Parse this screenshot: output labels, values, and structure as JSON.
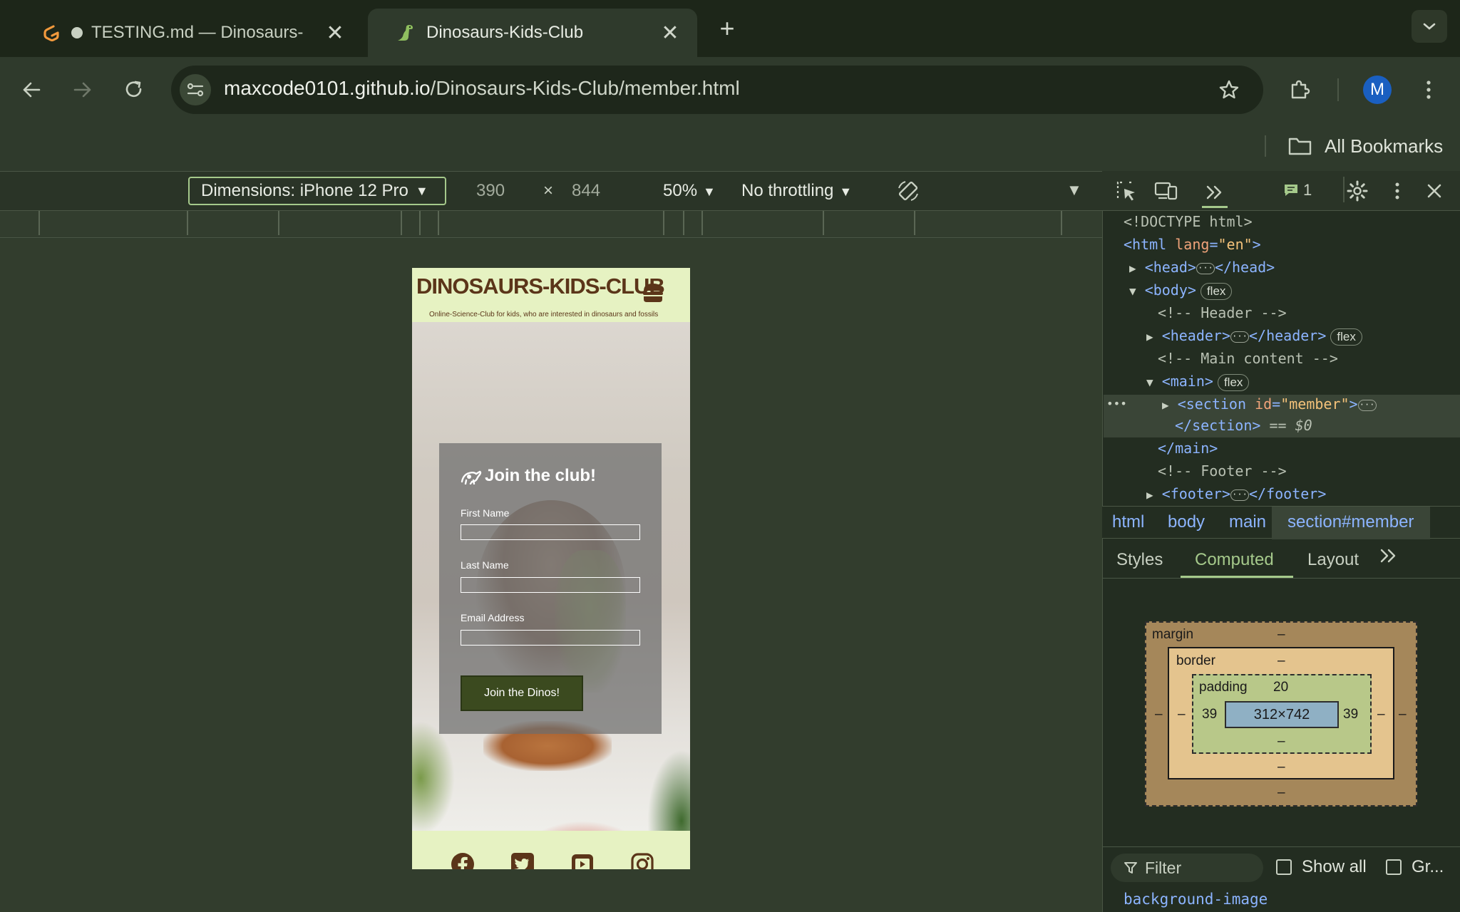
{
  "tabs": [
    {
      "title": "TESTING.md — Dinosaurs-",
      "active": false,
      "unsaved": true
    },
    {
      "title": "Dinosaurs-Kids-Club",
      "active": true
    }
  ],
  "address": {
    "host": "maxcode0101.github.io",
    "path": "/Dinosaurs-Kids-Club/member.html"
  },
  "profile_initial": "M",
  "bookmarks_label": "All Bookmarks",
  "device_toolbar": {
    "dimensions": "Dimensions: iPhone 12 Pro",
    "width": "390",
    "times": "×",
    "height": "844",
    "zoom": "50%",
    "throttling": "No throttling"
  },
  "site": {
    "logo": "DINOSAURS-KIDS-CLUB",
    "tagline": "Online-Science-Club for kids, who are interested in dinosaurs and fossils",
    "form_title": "Join the club!",
    "first_name_label": "First Name",
    "last_name_label": "Last Name",
    "email_label": "Email Address",
    "button_label": "Join the Dinos!"
  },
  "devtools": {
    "issues_count": "1",
    "dom": {
      "doctype": "<!DOCTYPE html>",
      "html_open": "<html",
      "lang_attr": "lang",
      "lang_val": "\"en\"",
      "head": "<head>",
      "head_close": "</head>",
      "body": "<body>",
      "flex": "flex",
      "c_header": "<!-- Header -->",
      "header": "<header>",
      "header_close": "</header>",
      "c_main": "<!-- Main content -->",
      "main": "<main>",
      "section_open": "<section",
      "id_attr": "id",
      "id_val": "\"member\"",
      "section_close": "</section>",
      "eq": "== $0",
      "main_close": "</main>",
      "c_footer": "<!-- Footer -->",
      "footer": "<footer>",
      "footer_close": "</footer>"
    },
    "breadcrumbs": [
      "html",
      "body",
      "main",
      "section#member"
    ],
    "panel_tabs": [
      "Styles",
      "Computed",
      "Layout"
    ],
    "box_model": {
      "margin_label": "margin",
      "border_label": "border",
      "padding_label": "padding",
      "dash": "–",
      "padding_top": "20",
      "padding_left": "39",
      "padding_right": "39",
      "content": "312×742"
    },
    "filter_placeholder": "Filter",
    "show_all": "Show all",
    "group": "Gr...",
    "property": "background-image"
  }
}
